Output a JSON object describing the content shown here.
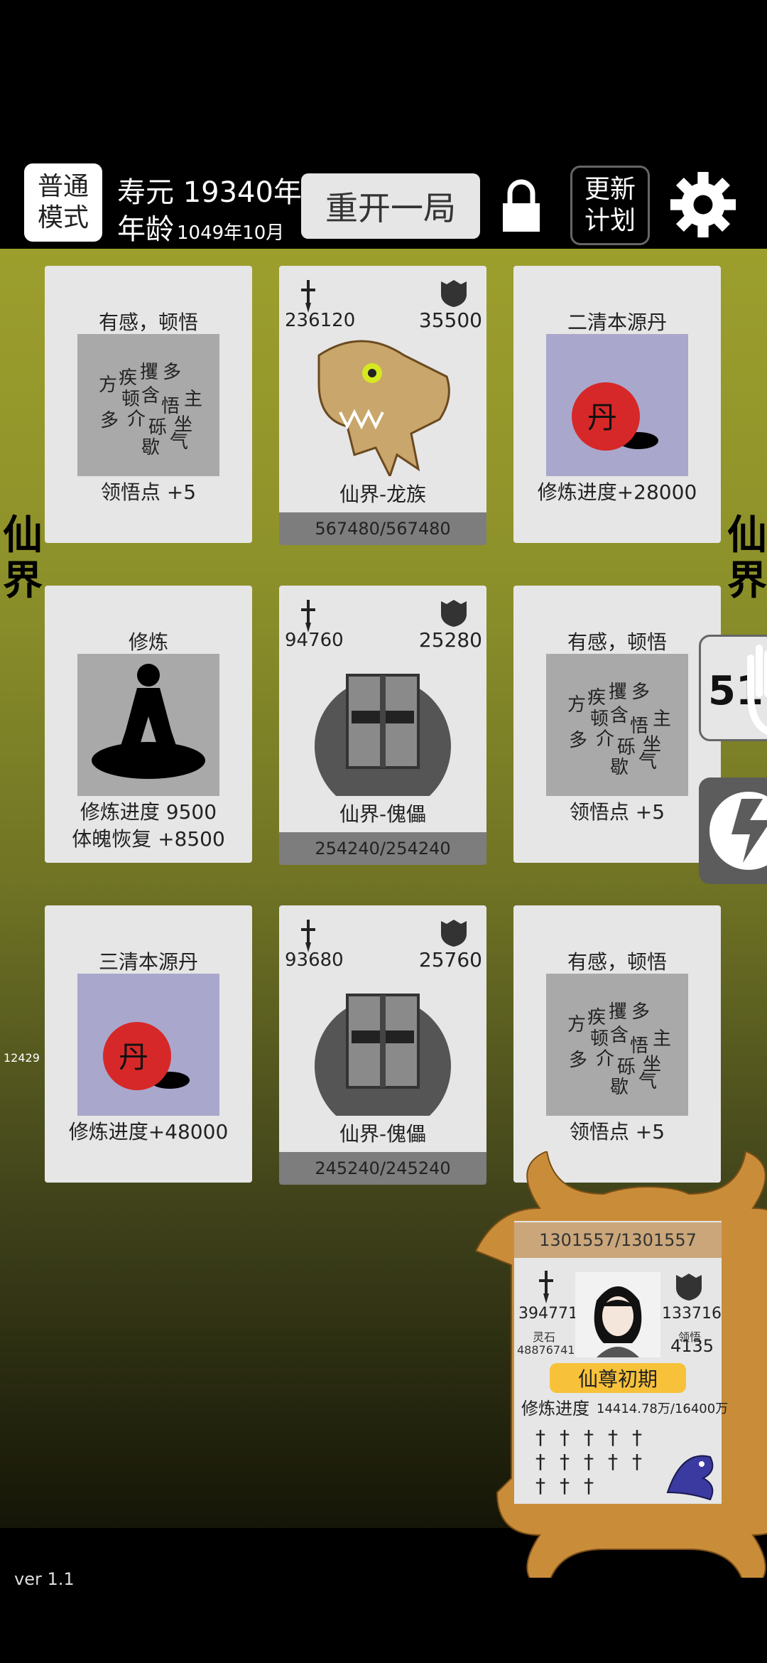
{
  "header": {
    "mode_line1": "普通",
    "mode_line2": "模式",
    "lifespan": "寿元 19340年",
    "age_label": "年龄",
    "age_value": "1049年10月",
    "restart_label": "重开一局",
    "update_line1": "更新",
    "update_line2": "计划"
  },
  "side": {
    "left_label_1": "仙",
    "left_label_2": "界",
    "right_label_1": "仙",
    "right_label_2": "界",
    "count": "51",
    "left_number": "12429"
  },
  "cards": [
    {
      "type": "event",
      "title": "有感，顿悟",
      "image": "calligraphy-insight",
      "desc_lines": [
        "领悟点  +5"
      ]
    },
    {
      "type": "enemy",
      "atk": "236120",
      "def": "35500",
      "image": "dragon-skull",
      "name": "仙界-龙族",
      "hp": "567480/567480"
    },
    {
      "type": "item",
      "title": "二清本源丹",
      "image": "red-pill",
      "desc_lines": [
        "修炼进度+28000"
      ]
    },
    {
      "type": "event",
      "title": "修炼",
      "image": "meditation-silhouette",
      "desc_lines": [
        "修炼进度  9500",
        "体魄恢复  +8500"
      ]
    },
    {
      "type": "enemy",
      "atk": "94760",
      "def": "25280",
      "image": "knight-helmet",
      "name": "仙界-傀儡",
      "hp": "254240/254240"
    },
    {
      "type": "event",
      "title": "有感，顿悟",
      "image": "calligraphy-insight",
      "desc_lines": [
        "领悟点  +5"
      ]
    },
    {
      "type": "item",
      "title": "三清本源丹",
      "image": "red-pill",
      "desc_lines": [
        "修炼进度+48000"
      ]
    },
    {
      "type": "enemy",
      "atk": "93680",
      "def": "25760",
      "image": "knight-helmet",
      "name": "仙界-傀儡",
      "hp": "245240/245240"
    },
    {
      "type": "event",
      "title": "有感，顿悟",
      "image": "calligraphy-insight",
      "desc_lines": [
        "领悟点  +5"
      ]
    }
  ],
  "player": {
    "hp": "1301557/1301557",
    "atk": "394771",
    "def": "133716",
    "stone_label": "灵石",
    "stone": "48876741",
    "insight_label": "领悟",
    "insight": "4135",
    "rank": "仙尊初期",
    "progress_label": "修炼进度",
    "progress_value": "14414.78万/16400万",
    "sword_count": 13
  },
  "footer": {
    "version": "ver 1.1"
  },
  "colors": {
    "field_top": "#9c9f2c",
    "card_bg": "#e6e6e6",
    "hp_bar": "#7d7d7d",
    "rank_badge": "#f7c23a",
    "pill_red": "#d62828",
    "pill_bg": "#aaa7cc"
  }
}
